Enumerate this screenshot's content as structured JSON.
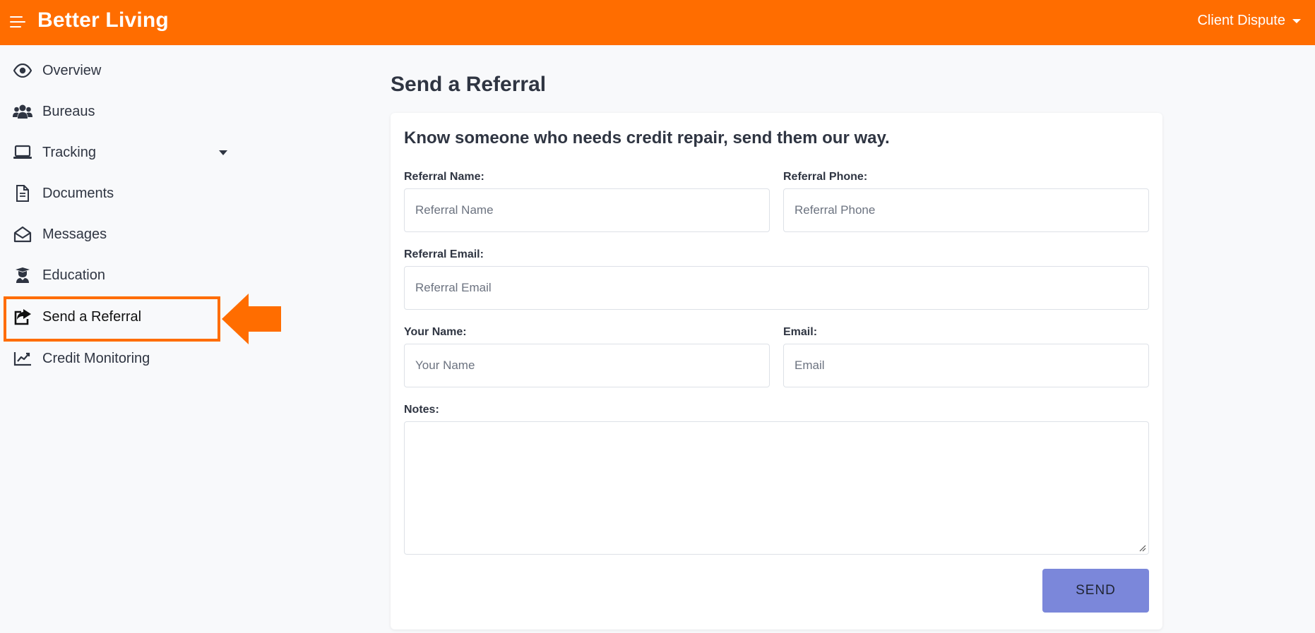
{
  "header": {
    "brand": "Better Living",
    "user_menu_label": "Client Dispute",
    "accent_color": "#ff6d00"
  },
  "sidebar": {
    "items": [
      {
        "label": "Overview",
        "icon": "eye-icon"
      },
      {
        "label": "Bureaus",
        "icon": "users-icon"
      },
      {
        "label": "Tracking",
        "icon": "laptop-icon",
        "has_dropdown": true
      },
      {
        "label": "Documents",
        "icon": "document-icon"
      },
      {
        "label": "Messages",
        "icon": "envelope-open-icon"
      },
      {
        "label": "Education",
        "icon": "graduate-icon"
      },
      {
        "label": "Send a Referral",
        "icon": "share-square-icon",
        "highlighted": true
      },
      {
        "label": "Credit Monitoring",
        "icon": "line-chart-icon"
      }
    ]
  },
  "main": {
    "page_title": "Send a Referral",
    "card_heading": "Know someone who needs credit repair, send them our way.",
    "form": {
      "referral_name": {
        "label": "Referral Name:",
        "placeholder": "Referral Name",
        "value": ""
      },
      "referral_phone": {
        "label": "Referral Phone:",
        "placeholder": "Referral Phone",
        "value": ""
      },
      "referral_email": {
        "label": "Referral Email:",
        "placeholder": "Referral Email",
        "value": ""
      },
      "your_name": {
        "label": "Your Name:",
        "placeholder": "Your Name",
        "value": ""
      },
      "email": {
        "label": "Email:",
        "placeholder": "Email",
        "value": ""
      },
      "notes": {
        "label": "Notes:",
        "value": ""
      },
      "send_label": "SEND"
    }
  },
  "colors": {
    "topbar": "#ff6d00",
    "highlight": "#ff6d00",
    "send_button": "#7b87da"
  }
}
